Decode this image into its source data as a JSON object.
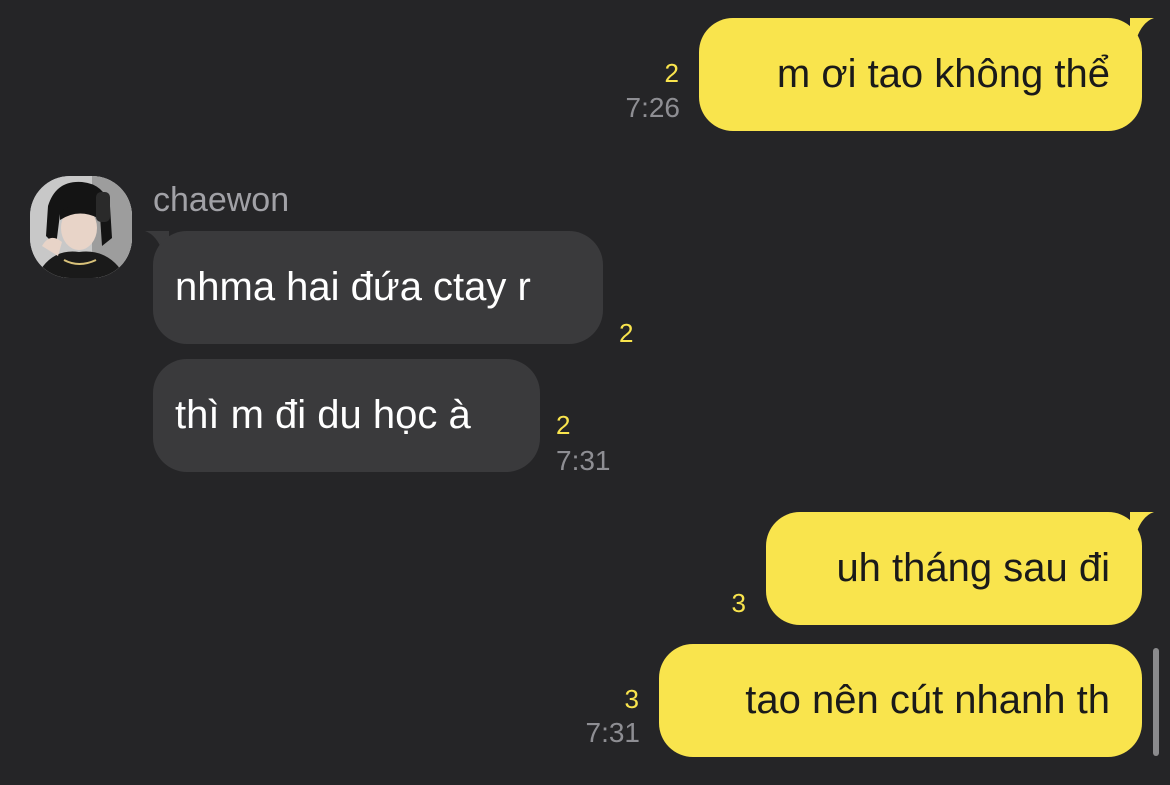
{
  "conversation": {
    "contact_name": "chaewon",
    "messages": [
      {
        "direction": "sent",
        "text": "m ơi tao không thể",
        "unread": "2",
        "time": "7:26"
      },
      {
        "direction": "received",
        "text": "nhma hai đứa ctay r",
        "unread": "2",
        "time": ""
      },
      {
        "direction": "received",
        "text": "thì m đi du học à",
        "unread": "2",
        "time": "7:31"
      },
      {
        "direction": "sent",
        "text": "uh tháng sau đi",
        "unread": "3",
        "time": ""
      },
      {
        "direction": "sent",
        "text": "tao nên cút nhanh th",
        "unread": "3",
        "time": "7:31"
      }
    ]
  },
  "colors": {
    "background": "#252527",
    "sent_bubble": "#f9e44d",
    "received_bubble": "#3a3a3c",
    "unread_count": "#f9e44d",
    "timestamp": "#8e8e93"
  }
}
